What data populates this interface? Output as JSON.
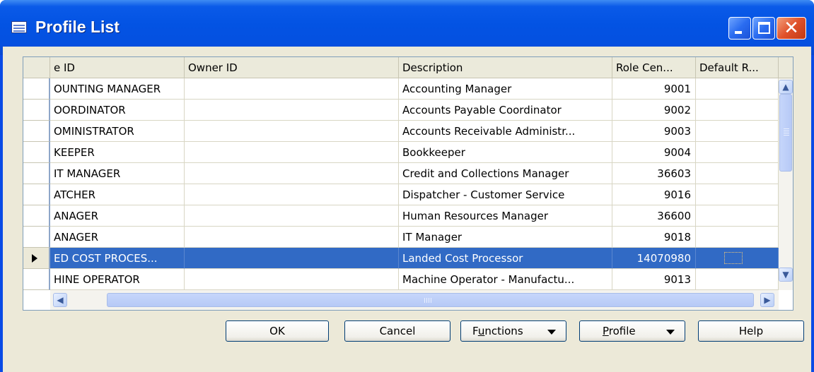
{
  "window": {
    "title": "Profile List"
  },
  "columns": [
    "e ID",
    "Owner ID",
    "Description",
    "Role Cen...",
    "Default R..."
  ],
  "rows": [
    {
      "id": "OUNTING MANAGER",
      "owner": "",
      "description": "Accounting Manager",
      "role_center": "9001",
      "default": ""
    },
    {
      "id": "OORDINATOR",
      "owner": "",
      "description": "Accounts Payable Coordinator",
      "role_center": "9002",
      "default": ""
    },
    {
      "id": "OMINISTRATOR",
      "owner": "",
      "description": "Accounts Receivable Administr...",
      "role_center": "9003",
      "default": ""
    },
    {
      "id": "KEEPER",
      "owner": "",
      "description": "Bookkeeper",
      "role_center": "9004",
      "default": ""
    },
    {
      "id": "IT MANAGER",
      "owner": "",
      "description": " Credit and Collections Manager",
      "role_center": "36603",
      "default": ""
    },
    {
      "id": "ATCHER",
      "owner": "",
      "description": "Dispatcher - Customer Service",
      "role_center": "9016",
      "default": ""
    },
    {
      "id": "ANAGER",
      "owner": "",
      "description": " Human Resources Manager",
      "role_center": "36600",
      "default": ""
    },
    {
      "id": "ANAGER",
      "owner": "",
      "description": "IT Manager",
      "role_center": "9018",
      "default": ""
    },
    {
      "id": "ED COST PROCES...",
      "owner": "",
      "description": "Landed Cost Processor",
      "role_center": "14070980",
      "default": ""
    },
    {
      "id": "HINE OPERATOR",
      "owner": "",
      "description": "Machine Operator - Manufactu...",
      "role_center": "9013",
      "default": ""
    }
  ],
  "buttons": {
    "ok": "OK",
    "cancel": "Cancel",
    "functions_pre": "F",
    "functions_u": "u",
    "functions_post": "nctions",
    "profile_u": "P",
    "profile_post": "rofile",
    "help": "Help"
  },
  "scroll_glyphs": {
    "up": "▲",
    "down": "▼",
    "left": "◀",
    "right": "▶"
  },
  "colors": {
    "title_bar": "#0353e3",
    "selection": "#316ac5",
    "dialog_bg": "#ece9d8"
  }
}
